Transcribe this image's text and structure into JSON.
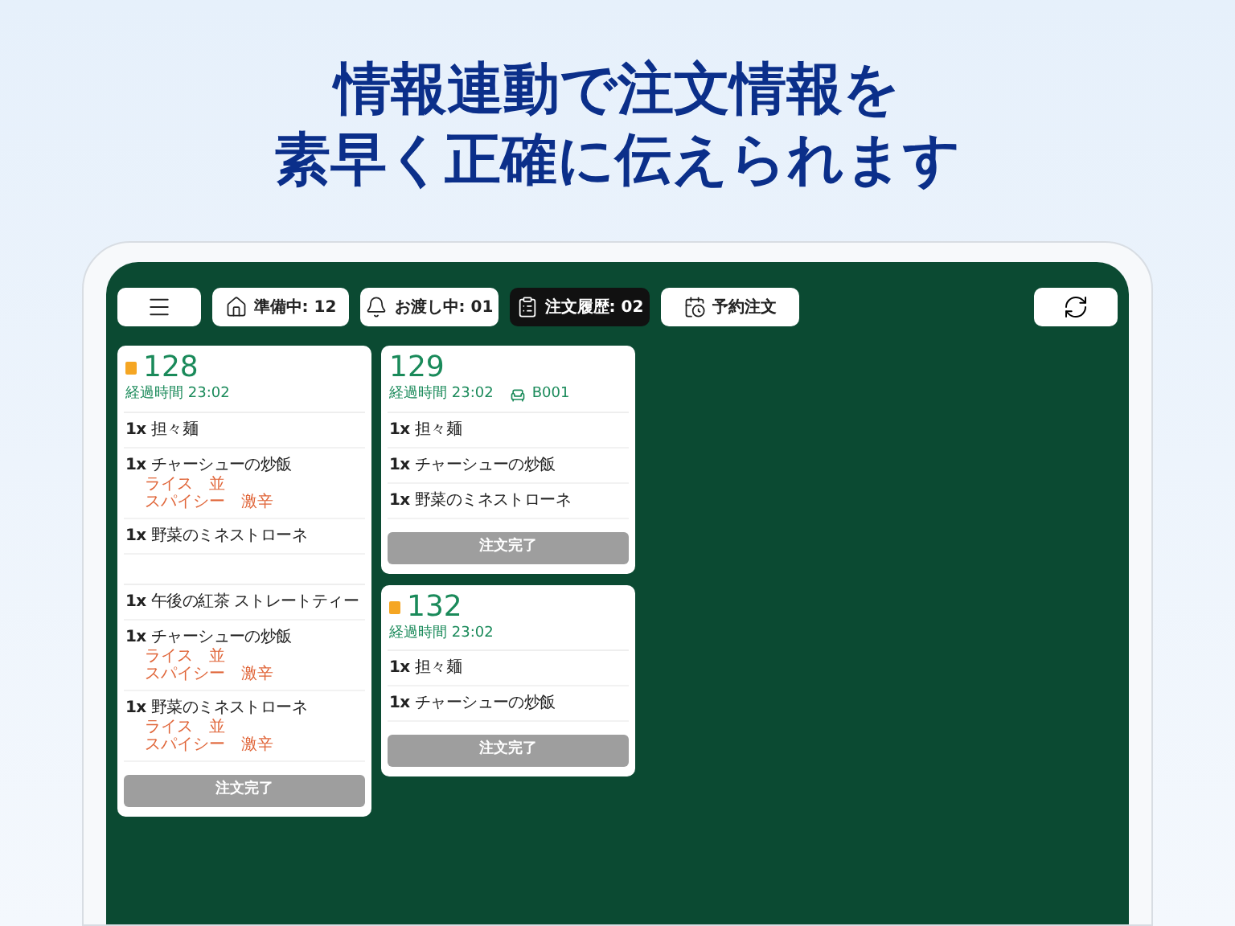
{
  "headline": [
    "情報連動で注文情報を",
    "素早く正確に伝えられます"
  ],
  "toolbar": {
    "buttons": [
      {
        "kind": "menu",
        "selected": false
      },
      {
        "kind": "tab",
        "label": "準備中: 12",
        "selected": false
      },
      {
        "kind": "tab",
        "label": "お渡し中: 01",
        "selected": false
      },
      {
        "kind": "tab",
        "label": "注文履歴: 02",
        "selected": true
      },
      {
        "kind": "tab",
        "label": "予約注文",
        "selected": false
      }
    ],
    "refresh": {
      "kind": "refresh"
    }
  },
  "columns": [
    {
      "orders": [
        {
          "number": "128",
          "flagged": true,
          "elapsed": "経過時間 23:02",
          "groups": [
            [
              {
                "qty": "1x",
                "name": "担々麺"
              },
              {
                "qty": "1x",
                "name": "チャーシューの炒飯",
                "options": [
                  "ライス　並",
                  "スパイシー　激辛"
                ]
              },
              {
                "qty": "1x",
                "name": "野菜のミネストローネ"
              }
            ],
            [
              {
                "qty": "1x",
                "name": "午後の紅茶 ストレートティー"
              },
              {
                "qty": "1x",
                "name": "チャーシューの炒飯",
                "options": [
                  "ライス　並",
                  "スパイシー　激辛"
                ]
              },
              {
                "qty": "1x",
                "name": "野菜のミネストローネ",
                "options": [
                  "ライス　並",
                  "スパイシー　激辛"
                ]
              }
            ]
          ],
          "action": "注文完了"
        }
      ]
    },
    {
      "orders": [
        {
          "number": "129",
          "flagged": false,
          "elapsed": "経過時間 23:02",
          "table": "B001",
          "groups": [
            [
              {
                "qty": "1x",
                "name": "担々麺"
              },
              {
                "qty": "1x",
                "name": "チャーシューの炒飯"
              },
              {
                "qty": "1x",
                "name": "野菜のミネストローネ"
              }
            ]
          ],
          "action": "注文完了"
        },
        {
          "number": "132",
          "flagged": true,
          "elapsed": "経過時間 23:02",
          "groups": [
            [
              {
                "qty": "1x",
                "name": "担々麺"
              },
              {
                "qty": "1x",
                "name": "チャーシューの炒飯"
              }
            ]
          ],
          "action": "注文完了"
        }
      ]
    }
  ]
}
